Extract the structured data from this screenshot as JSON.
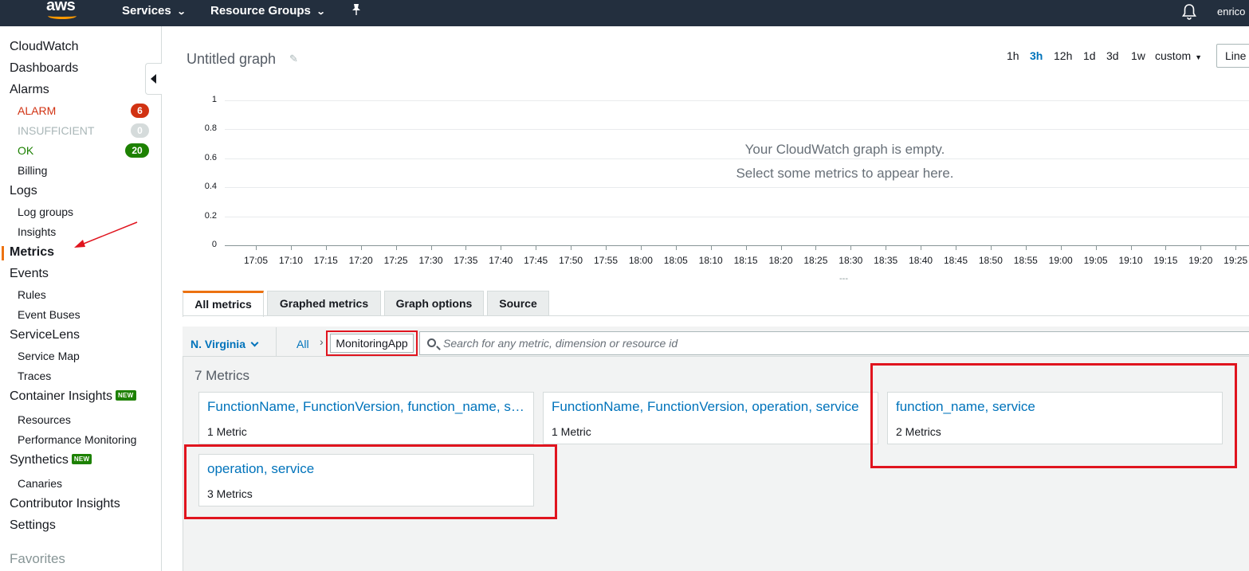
{
  "topnav": {
    "logo_text": "aws",
    "services_label": "Services",
    "resource_groups_label": "Resource Groups",
    "user_label": "enrico",
    "icons": [
      "pin-icon",
      "bell-icon",
      "chevron-down-icon"
    ]
  },
  "sidebar": {
    "cloudwatch": "CloudWatch",
    "dashboards": "Dashboards",
    "alarms": "Alarms",
    "alarm_label": "ALARM",
    "alarm_count": "6",
    "insufficient_label": "INSUFFICIENT",
    "insufficient_count": "0",
    "ok_label": "OK",
    "ok_count": "20",
    "billing": "Billing",
    "logs": "Logs",
    "log_groups": "Log groups",
    "insights": "Insights",
    "metrics": "Metrics",
    "events": "Events",
    "rules": "Rules",
    "event_buses": "Event Buses",
    "servicelens": "ServiceLens",
    "service_map": "Service Map",
    "traces": "Traces",
    "container_insights": "Container Insights",
    "new_badge": "NEW",
    "resources": "Resources",
    "performance_monitoring": "Performance Monitoring",
    "synthetics": "Synthetics",
    "canaries": "Canaries",
    "contributor_insights": "Contributor Insights",
    "settings": "Settings",
    "favorites": "Favorites",
    "colors": {
      "alarm": "#d13212",
      "ok": "#1d8102",
      "insufficient": "#aab7b8",
      "active_marker": "#ec7211"
    }
  },
  "graph": {
    "title": "Untitled graph",
    "time_ranges": [
      "1h",
      "3h",
      "12h",
      "1d",
      "3d",
      "1w"
    ],
    "selected_range": "3h",
    "custom_label": "custom",
    "view_type": "Line",
    "empty_line1": "Your CloudWatch graph is empty.",
    "empty_line2": "Select some metrics to appear here.",
    "legend_placeholder": "---"
  },
  "chart_data": {
    "type": "line",
    "title": "Untitled graph",
    "series": [],
    "y_ticks": [
      "0",
      "0.2",
      "0.4",
      "0.6",
      "0.8",
      "1"
    ],
    "ylim": [
      0,
      1
    ],
    "x_ticks": [
      "17:05",
      "17:10",
      "17:15",
      "17:20",
      "17:25",
      "17:30",
      "17:35",
      "17:40",
      "17:45",
      "17:50",
      "17:55",
      "18:00",
      "18:05",
      "18:10",
      "18:15",
      "18:20",
      "18:25",
      "18:30",
      "18:35",
      "18:40",
      "18:45",
      "18:50",
      "18:55",
      "19:00",
      "19:05",
      "19:10",
      "19:15",
      "19:20",
      "19:25"
    ],
    "grid": true
  },
  "tabs": {
    "all_metrics": "All metrics",
    "graphed_metrics": "Graphed metrics",
    "graph_options": "Graph options",
    "source": "Source"
  },
  "browser": {
    "region": "N. Virginia",
    "crumb_all": "All",
    "crumb_separator": "›",
    "crumb_current": "MonitoringApp",
    "search_placeholder": "Search for any metric, dimension or resource id",
    "metrics_count": "7 Metrics",
    "cards": [
      {
        "title": "FunctionName, FunctionVersion, function_name, service",
        "subtitle": "1 Metric"
      },
      {
        "title": "FunctionName, FunctionVersion, operation, service",
        "subtitle": "1 Metric"
      },
      {
        "title": "function_name, service",
        "subtitle": "2 Metrics"
      },
      {
        "title": "operation, service",
        "subtitle": "3 Metrics"
      }
    ]
  },
  "annotations": {
    "highlight_color": "#e0141e"
  }
}
